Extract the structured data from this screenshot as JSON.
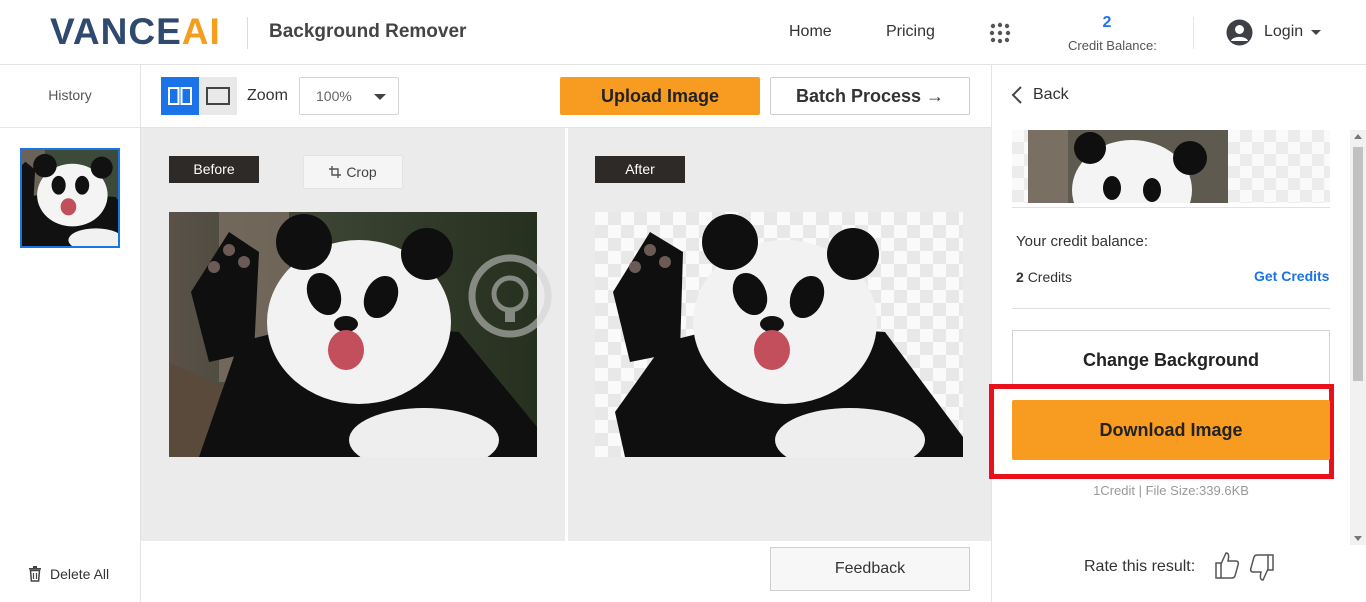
{
  "header": {
    "logo_main": "VANCE",
    "logo_accent": "AI",
    "app_title": "Background Remover",
    "nav_home": "Home",
    "nav_pricing": "Pricing",
    "credit_count": "2",
    "credit_label": "Credit Balance:",
    "login_label": "Login"
  },
  "sidebar": {
    "history_label": "History",
    "delete_all_label": "Delete All"
  },
  "toolbar": {
    "zoom_label": "Zoom",
    "zoom_value": "100%",
    "upload_label": "Upload Image",
    "batch_label": "Batch Process →"
  },
  "workspace": {
    "before_tag": "Before",
    "crop_label": "Crop",
    "after_tag": "After",
    "feedback_label": "Feedback"
  },
  "right_panel": {
    "back_label": "Back",
    "credit_title": "Your credit balance:",
    "credit_amount_number": "2",
    "credit_amount_unit": "Credits",
    "get_credits_label": "Get Credits",
    "change_background_label": "Change Background",
    "download_label": "Download Image",
    "file_info": "1Credit | File Size:339.6KB",
    "rate_label": "Rate this result:"
  },
  "colors": {
    "brand_navy": "#2f4a6e",
    "brand_orange": "#f79c21",
    "link_blue": "#1b73e8",
    "highlight_red": "#e8101a"
  },
  "icons": [
    "apps-grid-icon",
    "user-icon",
    "caret-down-icon",
    "split-view-icon",
    "single-view-icon",
    "crop-icon",
    "trash-icon",
    "back-chevron-icon",
    "thumbs-up-icon",
    "thumbs-down-icon"
  ]
}
